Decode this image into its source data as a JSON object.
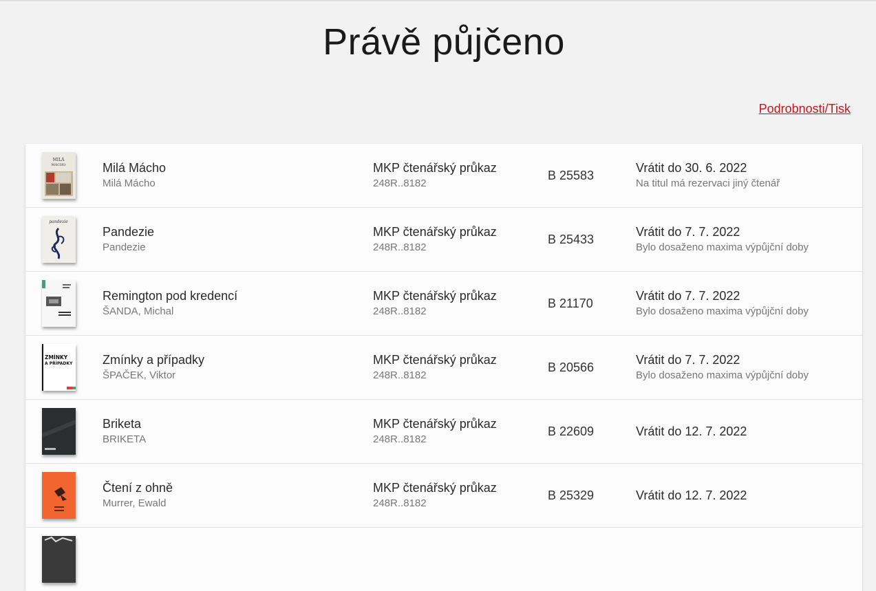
{
  "page": {
    "title": "Právě půjčeno",
    "details_link": "Podrobnosti/Tisk"
  },
  "loans": [
    {
      "title": "Milá Mácho",
      "author": "Milá Mácho",
      "card": "MKP čtenářský průkaz",
      "card_no": "248R..8182",
      "barcode": "B 25583",
      "due": "Vrátit do 30. 6. 2022",
      "note": "Na titul má rezervaci jiný čtenář",
      "cover_text": "MILÁ MÁCHO"
    },
    {
      "title": "Pandezie",
      "author": "Pandezie",
      "card": "MKP čtenářský průkaz",
      "card_no": "248R..8182",
      "barcode": "B 25433",
      "due": "Vrátit do 7. 7. 2022",
      "note": "Bylo dosaženo maxima výpůjční doby",
      "cover_text": "pandezie"
    },
    {
      "title": "Remington pod kredencí",
      "author": "ŠANDA, Michal",
      "card": "MKP čtenářský průkaz",
      "card_no": "248R..8182",
      "barcode": "B 21170",
      "due": "Vrátit do 7. 7. 2022",
      "note": "Bylo dosaženo maxima výpůjční doby",
      "cover_text": ""
    },
    {
      "title": "Zmínky a případky",
      "author": "ŠPAČEK, Viktor",
      "card": "MKP čtenářský průkaz",
      "card_no": "248R..8182",
      "barcode": "B 20566",
      "due": "Vrátit do 7. 7. 2022",
      "note": "Bylo dosaženo maxima výpůjční doby",
      "cover_text": "ZMÍNKY A PŘÍPADKY"
    },
    {
      "title": "Briketa",
      "author": "BRIKETA",
      "card": "MKP čtenářský průkaz",
      "card_no": "248R..8182",
      "barcode": "B 22609",
      "due": "Vrátit do 12. 7. 2022",
      "note": "",
      "cover_text": ""
    },
    {
      "title": "Čtení z ohně",
      "author": "Murrer, Ewald",
      "card": "MKP čtenářský průkaz",
      "card_no": "248R..8182",
      "barcode": "B 25329",
      "due": "Vrátit do 12. 7. 2022",
      "note": "",
      "cover_text": ""
    }
  ],
  "colors": {
    "accent": "#c0171b",
    "background": "#f2f2f2",
    "card": "#fcfcfc"
  }
}
